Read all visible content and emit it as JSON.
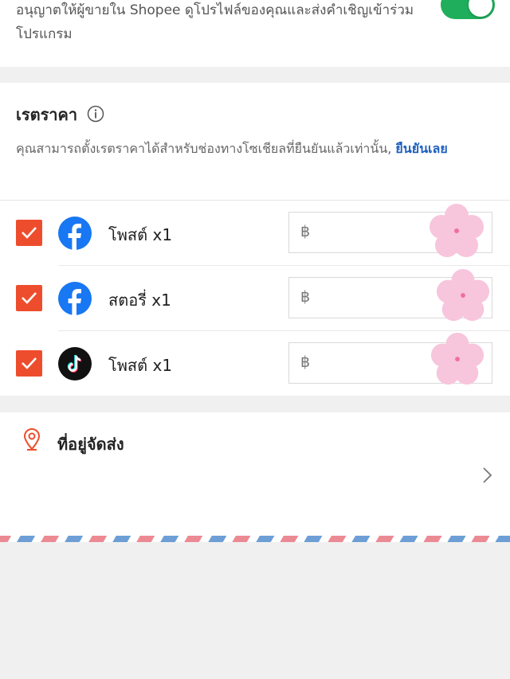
{
  "top_card": {
    "consent_text": "อนุญาตให้ผู้ขายใน Shopee ดูโปรไฟล์ของคุณและส่งคำเชิญเข้าร่วมโปรแกรม",
    "toggle_on": true
  },
  "rate": {
    "title": "เรตราคา",
    "description": "คุณสามารถตั้งเรตราคาได้สำหรับช่องทางโซเชียลที่ยืนยันแล้วเท่านั้น, ",
    "verify_link": "ยืนยันเลย",
    "currency_symbol": "฿",
    "rows": [
      {
        "platform": "facebook",
        "icon": "facebook-icon",
        "label": "โพสต์ x1",
        "checked": true,
        "price": ""
      },
      {
        "platform": "facebook",
        "icon": "facebook-icon",
        "label": "สตอรี่ x1",
        "checked": true,
        "price": ""
      },
      {
        "platform": "tiktok",
        "icon": "tiktok-icon",
        "label": "โพสต์ x1",
        "checked": true,
        "price": ""
      }
    ]
  },
  "address": {
    "title": "ที่อยู่จัดส่ง"
  },
  "colors": {
    "accent": "#ee4d2d",
    "toggle_on": "#1fae5b",
    "link": "#1e5fbf",
    "facebook": "#1877f2",
    "sticker_pink": "#f7c5dc"
  }
}
